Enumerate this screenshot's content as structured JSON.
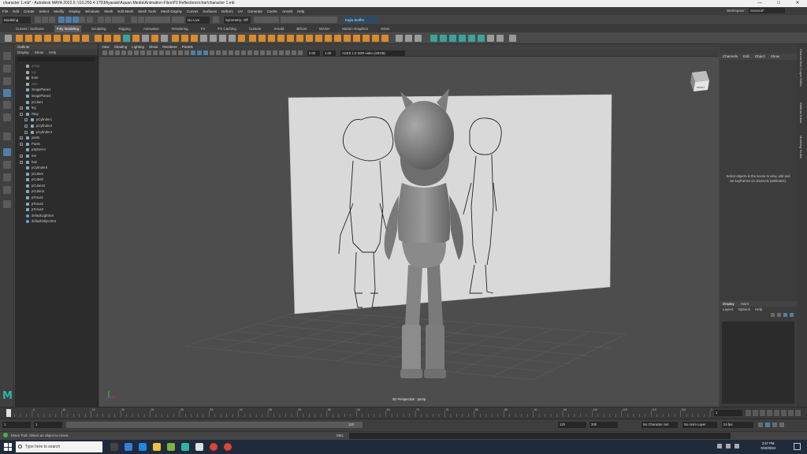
{
  "window": {
    "title": "character 1.mb* - Autodesk MAYA 2022.5: \\\\10.250.4.175\\Miyazaki\\Aquan-Media\\Animation-Files\\P3 Reflections\\char\\character 1.mb",
    "controls": [
      "—",
      "□",
      "✕"
    ]
  },
  "menubar": {
    "items": [
      "File",
      "Edit",
      "Create",
      "Select",
      "Modify",
      "Display",
      "Windows",
      "Mesh",
      "Edit Mesh",
      "Mesh Tools",
      "Mesh Display",
      "Curves",
      "Surfaces",
      "Deform",
      "UV",
      "Generate",
      "Cache",
      "Arnold",
      "Help"
    ],
    "workspace_label": "Workspace :",
    "workspace_value": "General*"
  },
  "statusline": {
    "mode": "Modeling",
    "live_surface": "No Live Surface",
    "symmetry": "Symmetry: Off",
    "user": "Kajia Stoffer"
  },
  "shelf": {
    "tabs": [
      "Curves / Surfaces",
      "Poly Modeling",
      "Sculpting",
      "Rigging",
      "Animation",
      "Rendering",
      "FX",
      "FX Caching",
      "Custom",
      "Arnold",
      "Bifrost",
      "MASH",
      "Motion Graphics",
      "XGen"
    ],
    "active_tab": "Poly Modeling"
  },
  "outliner": {
    "title": "Outliner",
    "menu": [
      "Display",
      "Show",
      "Help"
    ],
    "items": [
      {
        "label": "persp",
        "kind": "cam",
        "indent": 0,
        "dim": true,
        "expand": ""
      },
      {
        "label": "top",
        "kind": "cam",
        "indent": 0,
        "dim": true,
        "expand": ""
      },
      {
        "label": "front",
        "kind": "cam",
        "indent": 0,
        "dim": false,
        "expand": ""
      },
      {
        "label": "side",
        "kind": "cam",
        "indent": 0,
        "dim": true,
        "expand": ""
      },
      {
        "label": "imagePlane1",
        "kind": "mesh",
        "indent": 0,
        "dim": false,
        "expand": ""
      },
      {
        "label": "imagePlane2",
        "kind": "mesh",
        "indent": 0,
        "dim": false,
        "expand": ""
      },
      {
        "label": "pCube1",
        "kind": "mesh",
        "indent": 0,
        "dim": false,
        "expand": ""
      },
      {
        "label": "leg",
        "kind": "mesh",
        "indent": 0,
        "dim": false,
        "expand": "+"
      },
      {
        "label": "Ring",
        "kind": "mesh",
        "indent": 0,
        "dim": false,
        "expand": "−"
      },
      {
        "label": "pCylinder1",
        "kind": "mesh",
        "indent": 1,
        "dim": false,
        "expand": "+"
      },
      {
        "label": "pCylinder2",
        "kind": "mesh",
        "indent": 1,
        "dim": false,
        "expand": "+"
      },
      {
        "label": "pCylinder3",
        "kind": "mesh",
        "indent": 1,
        "dim": false,
        "expand": "+"
      },
      {
        "label": "pants",
        "kind": "mesh",
        "indent": 0,
        "dim": false,
        "expand": "+"
      },
      {
        "label": "Pants",
        "kind": "mesh",
        "indent": 0,
        "dim": false,
        "expand": "+"
      },
      {
        "label": "pSphere1",
        "kind": "mesh",
        "indent": 0,
        "dim": false,
        "expand": ""
      },
      {
        "label": "ear",
        "kind": "mesh",
        "indent": 0,
        "dim": false,
        "expand": "+"
      },
      {
        "label": "hair",
        "kind": "mesh",
        "indent": 0,
        "dim": false,
        "expand": "+"
      },
      {
        "label": "pCylinder6",
        "kind": "mesh",
        "indent": 0,
        "dim": false,
        "expand": ""
      },
      {
        "label": "pCube9",
        "kind": "mesh",
        "indent": 0,
        "dim": false,
        "expand": ""
      },
      {
        "label": "pCube8",
        "kind": "mesh",
        "indent": 0,
        "dim": false,
        "expand": ""
      },
      {
        "label": "pCube10",
        "kind": "mesh",
        "indent": 0,
        "dim": false,
        "expand": ""
      },
      {
        "label": "pCube11",
        "kind": "mesh",
        "indent": 0,
        "dim": false,
        "expand": ""
      },
      {
        "label": "pTorus1",
        "kind": "mesh",
        "indent": 0,
        "dim": false,
        "expand": ""
      },
      {
        "label": "pTorus2",
        "kind": "mesh",
        "indent": 0,
        "dim": false,
        "expand": ""
      },
      {
        "label": "pTorus3",
        "kind": "mesh",
        "indent": 0,
        "dim": false,
        "expand": ""
      },
      {
        "label": "defaultLightSet",
        "kind": "set",
        "indent": 0,
        "dim": false,
        "expand": ""
      },
      {
        "label": "defaultObjectSet",
        "kind": "set",
        "indent": 0,
        "dim": false,
        "expand": ""
      }
    ]
  },
  "viewport": {
    "menu": [
      "View",
      "Shading",
      "Lighting",
      "Show",
      "Renderer",
      "Panels"
    ],
    "near_value": "0.00",
    "far_value": "1.00",
    "color_space": "ACES 1.0 SDR-video (sRGB)",
    "camera_label": "3D Perspective : persp",
    "cube_label": "FRONT"
  },
  "channelbox": {
    "menu": [
      "Channels",
      "Edit",
      "Object",
      "Show"
    ],
    "message": "Select objects in the scene to view, edit and set keyframes on channels (attributes)."
  },
  "layers": {
    "tabs": [
      "Display",
      "Anim"
    ],
    "active_tab": "Display",
    "menu": [
      "Layers",
      "Options",
      "Help"
    ]
  },
  "sidetabs": [
    "Channel Box / Layer Editor",
    "Attribute Editor",
    "Modeling Toolkit"
  ],
  "timeslider": {
    "current_frame": "1",
    "tick_labels": [
      "5",
      "10",
      "15",
      "20",
      "25",
      "30",
      "35",
      "40",
      "45",
      "50",
      "55",
      "60",
      "65",
      "70",
      "75",
      "80",
      "85",
      "90",
      "95",
      "100",
      "105",
      "110",
      "115",
      "120"
    ]
  },
  "range": {
    "start": "1",
    "inner_start": "1",
    "inner_end": "120",
    "end_a": "120",
    "end_b": "200",
    "character_set": "No Character Set",
    "anim_layer": "No Anim Layer",
    "fps": "24 fps"
  },
  "helpline": {
    "mel_label": "MEL",
    "message": "Move Tool: Select an object to move."
  },
  "taskbar": {
    "search_placeholder": "Type here to search",
    "time": "2:57 PM",
    "date": "9/19/2024"
  },
  "colors": {
    "accent": "#4f7fa8",
    "shelf_orange": "#d98a2b",
    "maya_teal": "#2fb5a8",
    "taskbar": "#1f2a3a"
  }
}
